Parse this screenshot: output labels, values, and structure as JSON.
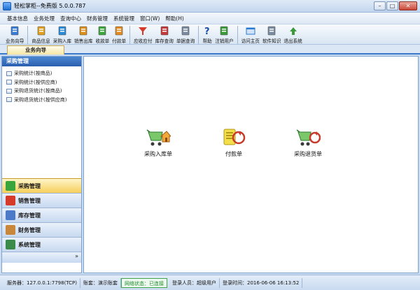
{
  "window": {
    "title": "轻松掌柜--免费版   5.0.0.787",
    "min": "–",
    "max": "□",
    "close": "✕"
  },
  "menu": [
    "基本信息",
    "业务处理",
    "查询中心",
    "财务管理",
    "系统管理",
    "窗口(W)",
    "帮助(H)"
  ],
  "toolbar": [
    {
      "label": "业务向导",
      "icon": "book-icon",
      "color": "#3a7bd5"
    },
    {
      "sep": true
    },
    {
      "label": "商品信息",
      "icon": "product-icon",
      "color": "#e0a020"
    },
    {
      "label": "采购入库",
      "icon": "purchase-icon",
      "color": "#2a8ad6"
    },
    {
      "label": "销售出库",
      "icon": "sales-icon",
      "color": "#d98f1a"
    },
    {
      "label": "收款单",
      "icon": "receipt-icon",
      "color": "#3aa53a"
    },
    {
      "label": "付款单",
      "icon": "payment-icon",
      "color": "#e08a20"
    },
    {
      "sep": true
    },
    {
      "label": "应收应付",
      "icon": "filter-icon",
      "color": "#d63a2a"
    },
    {
      "label": "库存查询",
      "icon": "stock-icon",
      "color": "#c43a3a"
    },
    {
      "label": "单据查询",
      "icon": "doc-icon",
      "color": "#7a8aa0"
    },
    {
      "sep": true
    },
    {
      "label": "帮助",
      "icon": "help-icon",
      "color": "#1a4ea8"
    },
    {
      "label": "注销用户",
      "icon": "logout-user-icon",
      "color": "#3a9a3a"
    },
    {
      "sep": true
    },
    {
      "label": "访问主页",
      "icon": "homepage-icon",
      "color": "#2a7ad0"
    },
    {
      "label": "软件知识",
      "icon": "knowledge-icon",
      "color": "#7a8aa0"
    },
    {
      "label": "退出系统",
      "icon": "exit-icon",
      "color": "#3a9a3a"
    }
  ],
  "tab": {
    "label": "业务向导"
  },
  "left_panel": {
    "header": "采购管理",
    "items": [
      "采购统计(按商品)",
      "采购统计(按供应商)",
      "采购退货统计(按商品)",
      "采购退货统计(按供应商)"
    ]
  },
  "nav": [
    {
      "label": "采购管理",
      "icon": "cart-icon",
      "color": "#3aa53a",
      "active": true
    },
    {
      "label": "销售管理",
      "icon": "check-doc-icon",
      "color": "#d63a2a",
      "active": false
    },
    {
      "label": "库存管理",
      "icon": "grid-icon",
      "color": "#4a7ac8",
      "active": false
    },
    {
      "label": "财务管理",
      "icon": "card-icon",
      "color": "#c8873a",
      "active": false
    },
    {
      "label": "系统管理",
      "icon": "book-green-icon",
      "color": "#3a8a4a",
      "active": false
    }
  ],
  "nav_more": "»",
  "main": {
    "shortcuts": [
      {
        "label": "采购入库单",
        "icon": "purchase-in-icon"
      },
      {
        "label": "付款单",
        "icon": "payment-voucher-icon"
      },
      {
        "label": "采购退货单",
        "icon": "purchase-return-icon"
      }
    ]
  },
  "status": {
    "server": "服务器：127.0.0.1:7798(TCP)",
    "account": "账套：演示账套",
    "network": "网络状态：已连接",
    "user": "登录人员：超级用户",
    "login_time": "登录时间：2016-06-06 16:13:52"
  }
}
